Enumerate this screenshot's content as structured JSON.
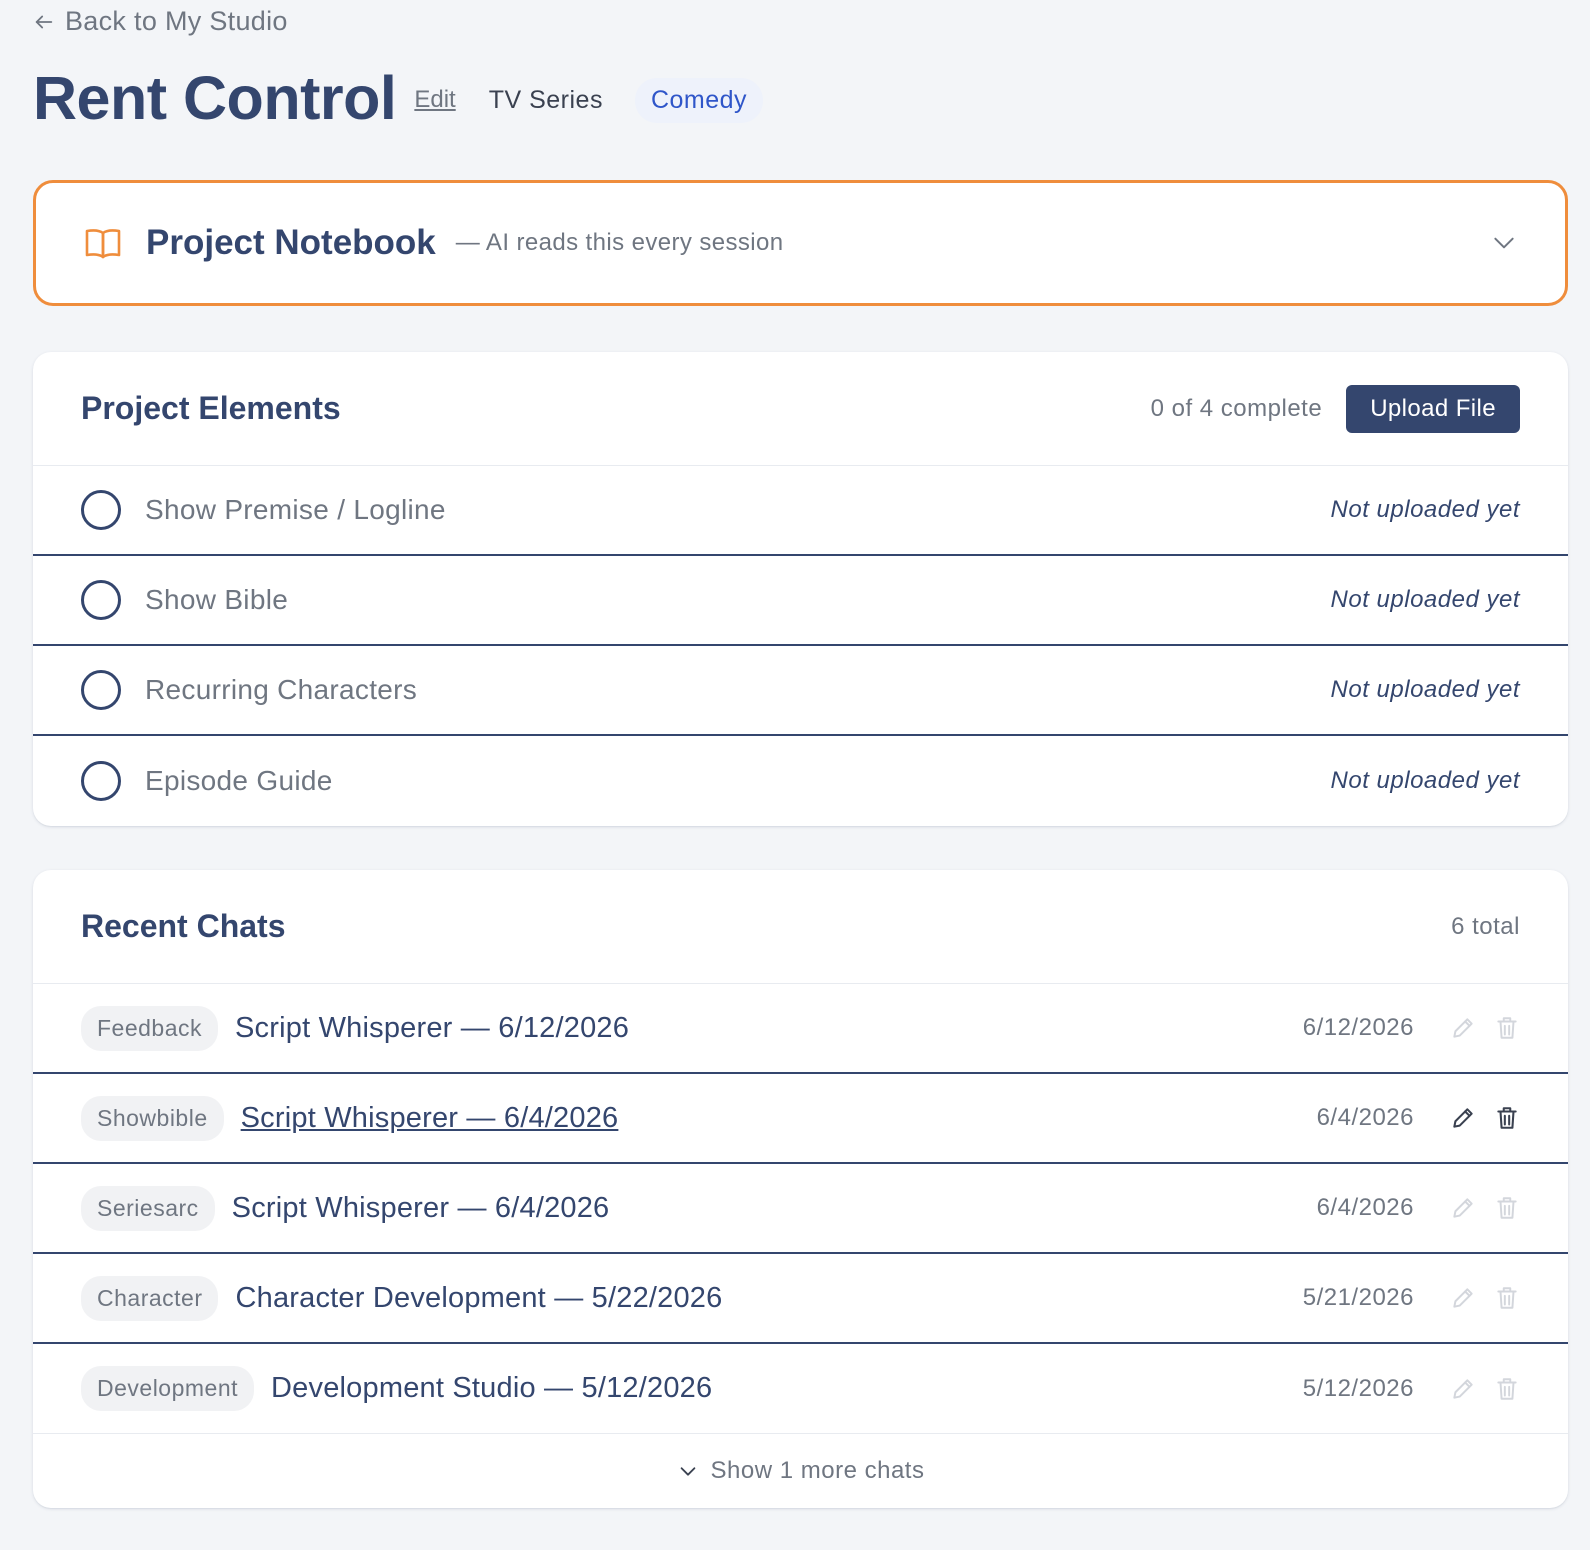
{
  "nav": {
    "back_label": "Back to My Studio"
  },
  "project": {
    "title": "Rent Control",
    "edit_label": "Edit",
    "type": "TV Series",
    "genre": "Comedy"
  },
  "notebook": {
    "title": "Project Notebook",
    "subtitle": "— AI reads this every session",
    "icon": "book-open-icon",
    "accent": "#ef8d3c"
  },
  "elements": {
    "title": "Project Elements",
    "progress": "0 of 4 complete",
    "upload_label": "Upload File",
    "items": [
      {
        "name": "Show Premise / Logline",
        "status": "Not uploaded yet"
      },
      {
        "name": "Show Bible",
        "status": "Not uploaded yet"
      },
      {
        "name": "Recurring Characters",
        "status": "Not uploaded yet"
      },
      {
        "name": "Episode Guide",
        "status": "Not uploaded yet"
      }
    ]
  },
  "chats": {
    "title": "Recent Chats",
    "total": "6 total",
    "items": [
      {
        "tag": "Feedback",
        "title": "Script Whisperer — 6/12/2026",
        "date": "6/12/2026"
      },
      {
        "tag": "Showbible",
        "title": "Script Whisperer — 6/4/2026",
        "date": "6/4/2026"
      },
      {
        "tag": "Seriesarc",
        "title": "Script Whisperer — 6/4/2026",
        "date": "6/4/2026"
      },
      {
        "tag": "Character",
        "title": "Character Development — 5/22/2026",
        "date": "5/21/2026"
      },
      {
        "tag": "Development",
        "title": "Development Studio — 5/12/2026",
        "date": "5/12/2026"
      }
    ],
    "show_more": "Show 1 more chats"
  },
  "colors": {
    "primary": "#34466e",
    "muted": "#6f7681",
    "genre_text": "#2f56c9",
    "background": "#f3f5f8"
  }
}
